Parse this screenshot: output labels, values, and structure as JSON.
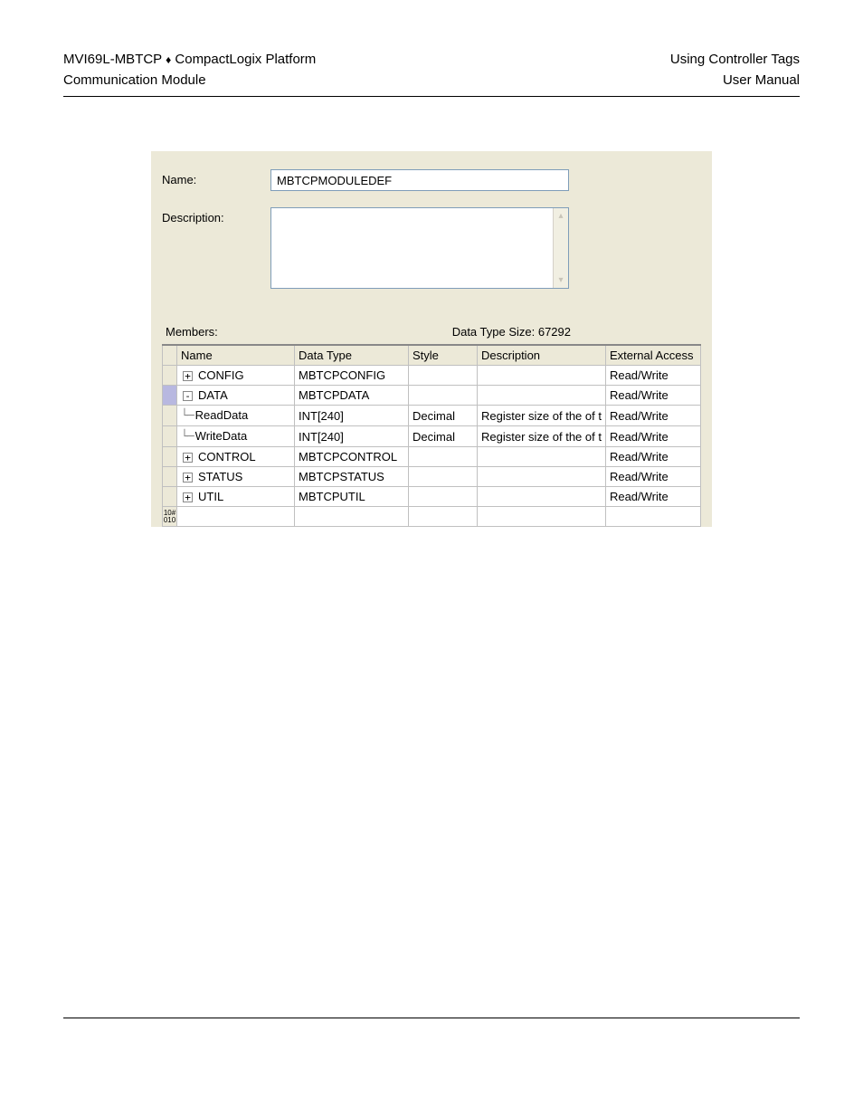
{
  "header": {
    "left_line1_a": "MVI69L-MBTCP",
    "left_line1_sep": "♦",
    "left_line1_b": "CompactLogix Platform",
    "left_line2": "Communication Module",
    "right_line1": "Using Controller Tags",
    "right_line2": "User Manual"
  },
  "form": {
    "name_label": "Name:",
    "name_value": "MBTCPMODULEDEF",
    "desc_label": "Description:",
    "desc_value": "",
    "members_label": "Members:",
    "data_type_size_label": "Data Type Size: 67292"
  },
  "columns": {
    "name": "Name",
    "data_type": "Data Type",
    "style": "Style",
    "description": "Description",
    "external_access": "External Access"
  },
  "rows": [
    {
      "indent": 0,
      "toggle": "+",
      "name": "CONFIG",
      "type": "MBTCPCONFIG",
      "style": "",
      "desc": "",
      "ext": "Read/Write",
      "sel": false
    },
    {
      "indent": 0,
      "toggle": "-",
      "name": "DATA",
      "type": "MBTCPDATA",
      "style": "",
      "desc": "",
      "ext": "Read/Write",
      "sel": true
    },
    {
      "indent": 1,
      "toggle": "",
      "name": "ReadData",
      "type": "INT[240]",
      "style": "Decimal",
      "desc": "Register size of the of t",
      "ext": "Read/Write",
      "sel": false
    },
    {
      "indent": 1,
      "toggle": "",
      "name": "WriteData",
      "type": "INT[240]",
      "style": "Decimal",
      "desc": "Register size of the of t",
      "ext": "Read/Write",
      "sel": false
    },
    {
      "indent": 0,
      "toggle": "+",
      "name": "CONTROL",
      "type": "MBTCPCONTROL",
      "style": "",
      "desc": "",
      "ext": "Read/Write",
      "sel": false
    },
    {
      "indent": 0,
      "toggle": "+",
      "name": "STATUS",
      "type": "MBTCPSTATUS",
      "style": "",
      "desc": "",
      "ext": "Read/Write",
      "sel": false
    },
    {
      "indent": 0,
      "toggle": "+",
      "name": "UTIL",
      "type": "MBTCPUTIL",
      "style": "",
      "desc": "",
      "ext": "Read/Write",
      "sel": false
    }
  ],
  "empty_row_stub": "10#\n010"
}
